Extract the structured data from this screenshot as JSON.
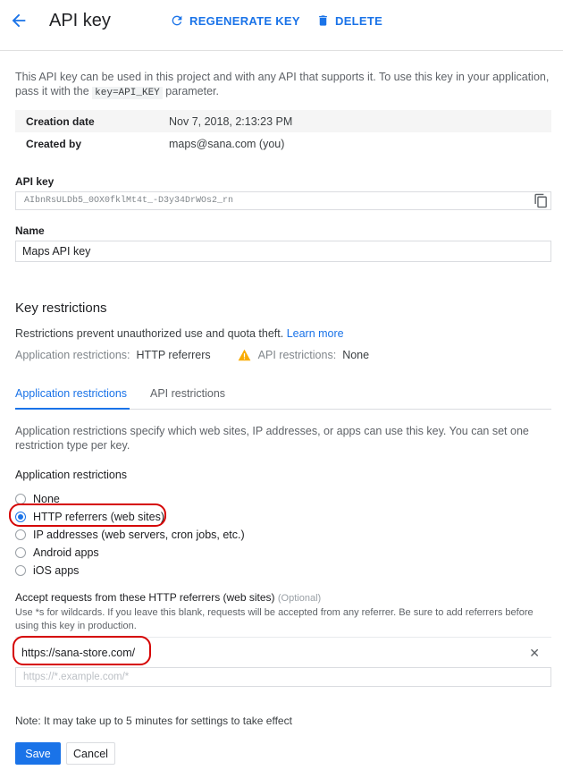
{
  "header": {
    "title": "API key",
    "regenerate_label": "REGENERATE KEY",
    "delete_label": "DELETE"
  },
  "description": {
    "before": "This API key can be used in this project and with any API that supports it. To use this key in your application, pass it with the ",
    "code": "key=API_KEY",
    "after": " parameter."
  },
  "info": {
    "rows": [
      {
        "key": "Creation date",
        "value": "Nov 7, 2018, 2:13:23 PM"
      },
      {
        "key": "Created by",
        "value": "maps@sana.com (you)"
      }
    ]
  },
  "api_key": {
    "label": "API key",
    "value": "AIbnRsULDb5_0OX0fklMt4t_-D3y34DrWOs2_rn"
  },
  "name": {
    "label": "Name",
    "value": "Maps API key"
  },
  "key_restrictions": {
    "title": "Key restrictions",
    "description": "Restrictions prevent unauthorized use and quota theft.",
    "learn_more": "Learn more",
    "app_restrictions_key": "Application restrictions:",
    "app_restrictions_value": "HTTP referrers",
    "api_restrictions_key": "API restrictions:",
    "api_restrictions_value": "None"
  },
  "tabs": [
    {
      "label": "Application restrictions",
      "active": true
    },
    {
      "label": "API restrictions",
      "active": false
    }
  ],
  "app_restrictions": {
    "description": "Application restrictions specify which web sites, IP addresses, or apps can use this key. You can set one restriction type per key.",
    "heading": "Application restrictions",
    "options": [
      {
        "label": "None",
        "checked": false
      },
      {
        "label": "HTTP referrers (web sites)",
        "checked": true
      },
      {
        "label": "IP addresses (web servers, cron jobs, etc.)",
        "checked": false
      },
      {
        "label": "Android apps",
        "checked": false
      },
      {
        "label": "iOS apps",
        "checked": false
      }
    ]
  },
  "referrers": {
    "label": "Accept requests from these HTTP referrers (web sites)",
    "optional": "(Optional)",
    "help": "Use *s for wildcards. If you leave this blank, requests will be accepted from any referrer. Be sure to add referrers before using this key in production.",
    "items": [
      "https://sana-store.com/"
    ],
    "remove_symbol": "✕",
    "placeholder": "https://*.example.com/*"
  },
  "note": "Note: It may take up to 5 minutes for settings to take effect",
  "actions": {
    "save": "Save",
    "cancel": "Cancel"
  },
  "colors": {
    "accent": "#1a73e8",
    "warning": "#f9ab00",
    "annotation": "#d50000"
  }
}
